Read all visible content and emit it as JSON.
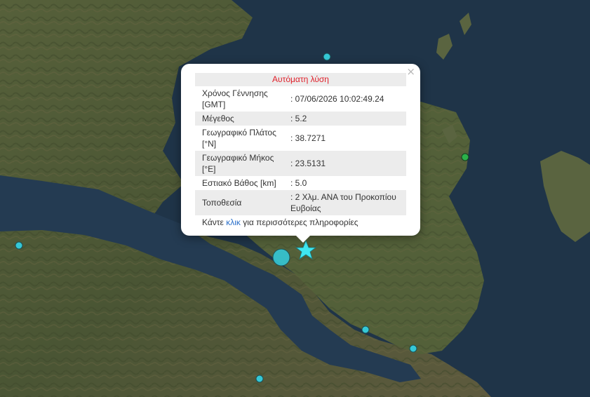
{
  "popup": {
    "title": "Αυτόματη λύση",
    "close_label": "×",
    "rows": [
      {
        "key": "Χρόνος Γέννησης [GMT]",
        "value": ": 07/06/2026 10:02:49.24"
      },
      {
        "key": "Μέγεθος",
        "value": ": 5.2"
      },
      {
        "key": "Γεωγραφικό Πλάτος [°N]",
        "value": ": 38.7271"
      },
      {
        "key": "Γεωγραφικό Μήκος [°E]",
        "value": ": 23.5131"
      },
      {
        "key": "Εστιακό Βάθος [km]",
        "value": ": 5.0"
      },
      {
        "key": "Τοποθεσία",
        "value": ": 2 Χλμ. ΑΝΑ του Προκοπίου Ευβοίας"
      }
    ],
    "more_prefix": "Κάντε ",
    "more_link": "κλικ",
    "more_suffix": " για περισσότερες πληροφορίες"
  },
  "colors": {
    "sea": "#1f3448",
    "land": "#4d5a35",
    "quake_recent": "#35c8d6",
    "quake_older": "#2bb04a",
    "star": "#3fe6f0",
    "title_red": "#e0202a"
  },
  "map": {
    "markers": [
      {
        "id": "event-star",
        "type": "star"
      },
      {
        "id": "quake-1",
        "type": "circle",
        "color": "recent"
      },
      {
        "id": "quake-2",
        "type": "circle",
        "color": "older"
      },
      {
        "id": "quake-3",
        "type": "circle",
        "color": "recent"
      }
    ]
  }
}
